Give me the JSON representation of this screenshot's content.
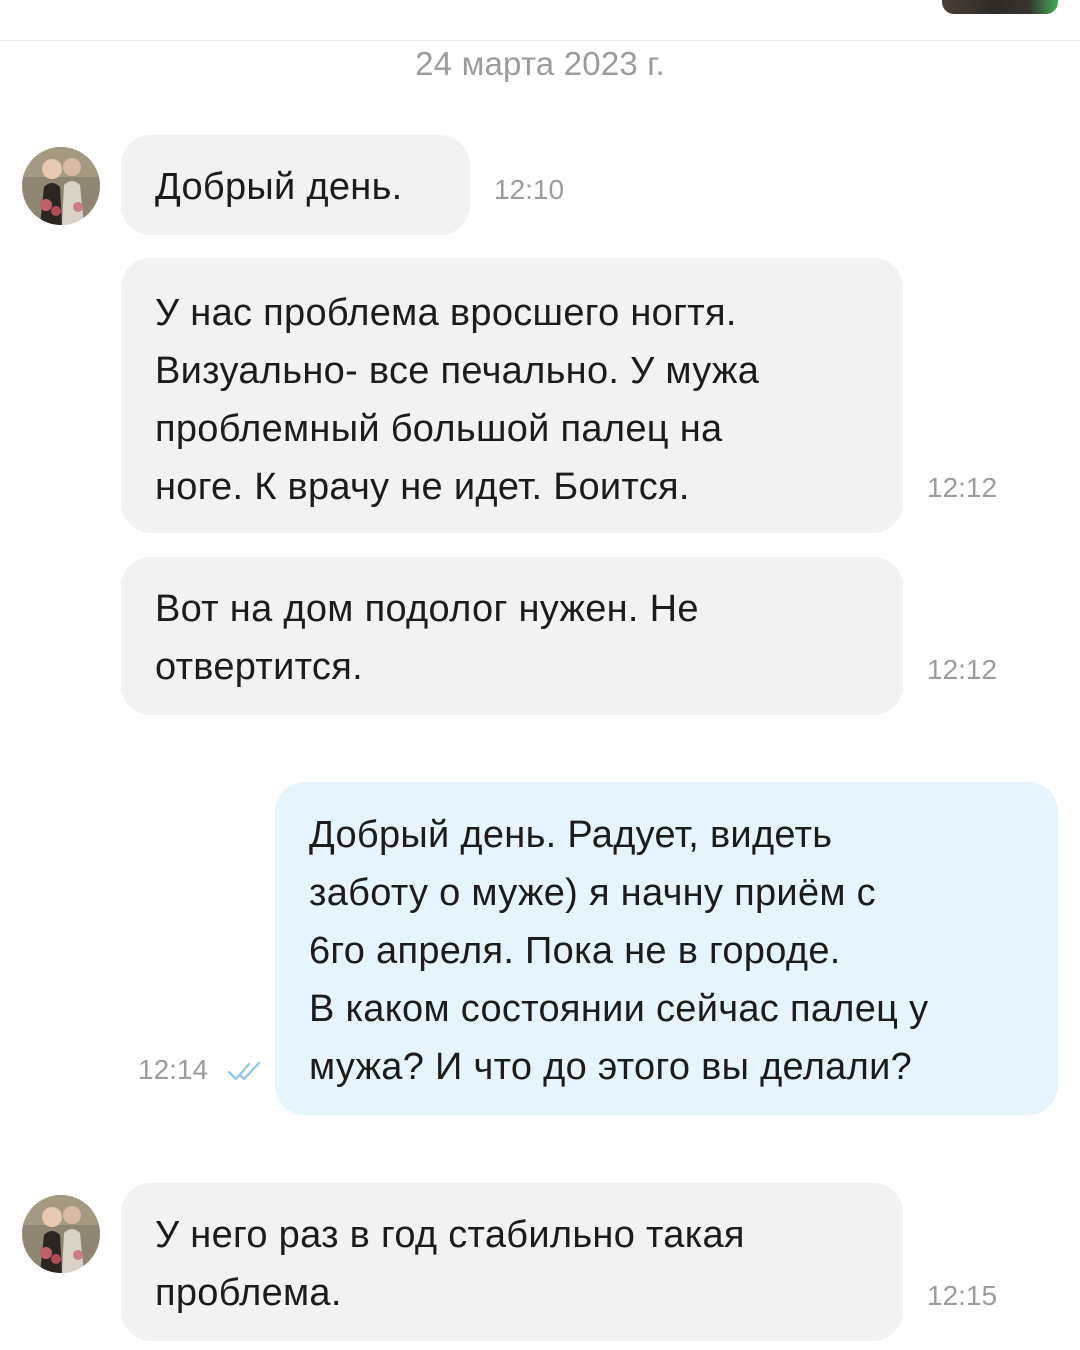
{
  "chat": {
    "date": "24 марта 2023 г.",
    "messages": [
      {
        "text": "Добрый день.",
        "time": "12:10"
      },
      {
        "text": "У нас проблема вросшего ногтя.\nВизуально- все печально. У мужа\nпроблемный большой палец на\nноге. К врачу не идет. Боится.",
        "time": "12:12"
      },
      {
        "text": "Вот на дом подолог нужен. Не\nотвертится.",
        "time": "12:12"
      },
      {
        "text": "Добрый день. Радует, видеть\nзаботу о муже) я начну приём с\n6го апреля. Пока не в городе.\nВ каком состоянии сейчас палец у\nмужа? И что до этого вы делали?",
        "time": "12:14",
        "status": "read"
      },
      {
        "text": "У него раз в год стабильно такая\nпроблема.",
        "time": "12:15"
      }
    ]
  },
  "colors": {
    "incoming_bubble": "#f2f2f2",
    "outgoing_bubble": "#e6f4fd",
    "meta_text": "#9c9c9c",
    "read_check": "#8fc4e8"
  },
  "icons": {
    "read_status": "double-check-icon",
    "avatar": "contact-avatar-photo"
  }
}
